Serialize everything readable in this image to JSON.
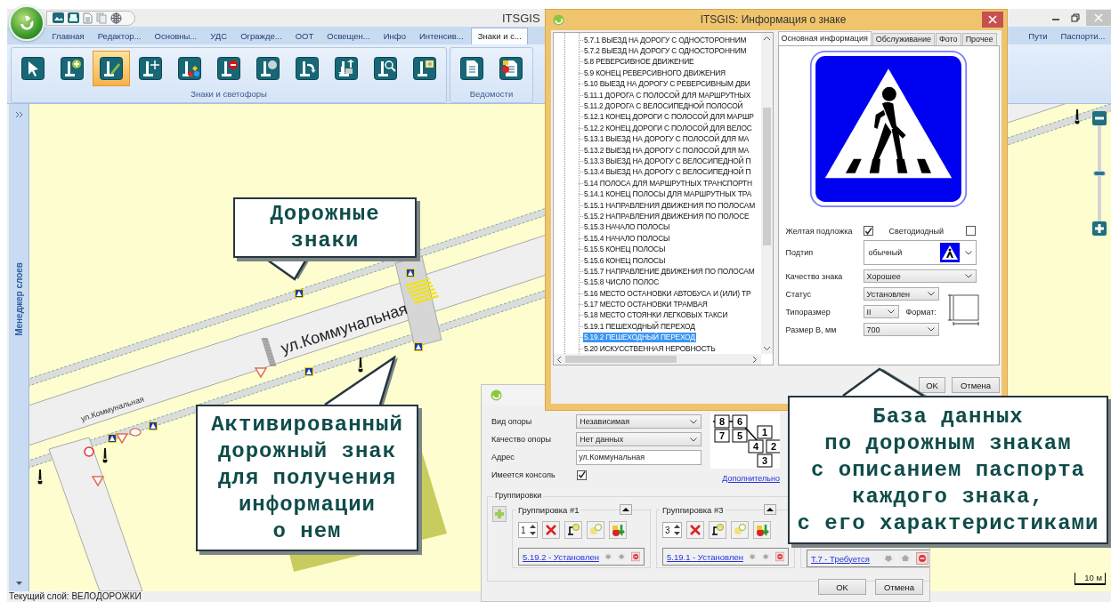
{
  "window": {
    "title": "ITSGIS"
  },
  "ribbon_tabs": [
    {
      "label": "Главная",
      "selected": false
    },
    {
      "label": "Редактор...",
      "selected": false
    },
    {
      "label": "Основны...",
      "selected": false
    },
    {
      "label": "УДС",
      "selected": false
    },
    {
      "label": "Огражде...",
      "selected": false
    },
    {
      "label": "ООТ",
      "selected": false
    },
    {
      "label": "Освещен...",
      "selected": false
    },
    {
      "label": "Инфо",
      "selected": false
    },
    {
      "label": "Интенсив...",
      "selected": false
    },
    {
      "label": "Знаки и с...",
      "selected": true
    }
  ],
  "ribbon_tabs_right": [
    {
      "label": "Пути",
      "selected": false
    },
    {
      "label": "Паспорти...",
      "selected": false
    }
  ],
  "ribbon_groups": [
    {
      "label": "Знаки и светофоры",
      "buttons": [
        {
          "selected": false
        },
        {
          "selected": false
        },
        {
          "selected": true
        },
        {
          "selected": false
        },
        {
          "selected": false
        },
        {
          "selected": false
        },
        {
          "selected": false
        },
        {
          "selected": false
        },
        {
          "selected": false
        },
        {
          "selected": false
        },
        {
          "selected": false
        }
      ]
    },
    {
      "label": "Ведомости",
      "buttons": [
        {
          "selected": false
        },
        {
          "selected": false
        }
      ]
    }
  ],
  "layers_panel": {
    "title": "Менеджер слоев"
  },
  "map": {
    "street_labels": [
      "ул.Коммунальная",
      "ул.Коммунальная"
    ],
    "scale": "10 м",
    "zoom": {
      "level": 0.5
    }
  },
  "status_bar": "Текущий слой: ВЕЛОДОРОЖКИ",
  "sign_dialog": {
    "title": "ITSGIS: Информация о знаке",
    "signs": [
      {
        "label": "5.7.1 ВЫЕЗД НА ДОРОГУ С ОДНОСТОРОННИМ",
        "selected": false
      },
      {
        "label": "5.7.2 ВЫЕЗД НА ДОРОГУ С ОДНОСТОРОННИМ",
        "selected": false
      },
      {
        "label": "5.8 РЕВЕРСИВНОЕ ДВИЖЕНИЕ",
        "selected": false
      },
      {
        "label": "5.9 КОНЕЦ РЕВЕРСИВНОГО ДВИЖЕНИЯ",
        "selected": false
      },
      {
        "label": "5.10 ВЫЕЗД НА ДОРОГУ С РЕВЕРСИВНЫМ ДВИ",
        "selected": false
      },
      {
        "label": "5.11.1 ДОРОГА С ПОЛОСОЙ ДЛЯ МАРШРУТНЫХ",
        "selected": false
      },
      {
        "label": "5.11.2 ДОРОГА С ВЕЛОСИПЕДНОЙ ПОЛОСОЙ",
        "selected": false
      },
      {
        "label": "5.12.1 КОНЕЦ ДОРОГИ С ПОЛОСОЙ ДЛЯ МАРШР",
        "selected": false
      },
      {
        "label": "5.12.2 КОНЕЦ ДОРОГИ С ПОЛОСОЙ ДЛЯ ВЕЛОС",
        "selected": false
      },
      {
        "label": "5.13.1 ВЫЕЗД НА ДОРОГУ С ПОЛОСОЙ ДЛЯ МА",
        "selected": false
      },
      {
        "label": "5.13.2 ВЫЕЗД НА ДОРОГУ С ПОЛОСОЙ ДЛЯ МА",
        "selected": false
      },
      {
        "label": "5.13.3 ВЫЕЗД НА ДОРОГУ С ВЕЛОСИПЕДНОЙ П",
        "selected": false
      },
      {
        "label": "5.13.4 ВЫЕЗД НА ДОРОГУ С ВЕЛОСИПЕДНОЙ П",
        "selected": false
      },
      {
        "label": "5.14 ПОЛОСА ДЛЯ МАРШРУТНЫХ ТРАНСПОРТН",
        "selected": false
      },
      {
        "label": "5.14.1 КОНЕЦ ПОЛОСЫ ДЛЯ МАРШРУТНЫХ ТРА",
        "selected": false
      },
      {
        "label": "5.15.1 НАПРАВЛЕНИЯ ДВИЖЕНИЯ ПО ПОЛОСАМ",
        "selected": false
      },
      {
        "label": "5.15.2 НАПРАВЛЕНИЯ ДВИЖЕНИЯ ПО ПОЛОСЕ",
        "selected": false
      },
      {
        "label": "5.15.3 НАЧАЛО ПОЛОСЫ",
        "selected": false
      },
      {
        "label": "5.15.4 НАЧАЛО ПОЛОСЫ",
        "selected": false
      },
      {
        "label": "5.15.5 КОНЕЦ ПОЛОСЫ",
        "selected": false
      },
      {
        "label": "5.15.6 КОНЕЦ ПОЛОСЫ",
        "selected": false
      },
      {
        "label": "5.15.7 НАПРАВЛЕНИЕ ДВИЖЕНИЯ ПО ПОЛОСАМ",
        "selected": false
      },
      {
        "label": "5.15.8 ЧИСЛО ПОЛОС",
        "selected": false
      },
      {
        "label": "5.16 МЕСТО ОСТАНОВКИ АВТОБУСА И (ИЛИ) ТР",
        "selected": false
      },
      {
        "label": "5.17 МЕСТО ОСТАНОВКИ ТРАМВАЯ",
        "selected": false
      },
      {
        "label": "5.18 МЕСТО СТОЯНКИ ЛЕГКОВЫХ ТАКСИ",
        "selected": false
      },
      {
        "label": "5.19.1 ПЕШЕХОДНЫЙ ПЕРЕХОД",
        "selected": false
      },
      {
        "label": "5.19.2 ПЕШЕХОДНЫЙ ПЕРЕХОД",
        "selected": true
      },
      {
        "label": "5.20 ИСКУССТВЕННАЯ НЕРОВНОСТЬ",
        "selected": false
      }
    ],
    "tabs": [
      {
        "label": "Основная информация",
        "selected": true
      },
      {
        "label": "Обслуживание",
        "selected": false
      },
      {
        "label": "Фото",
        "selected": false
      },
      {
        "label": "Прочее",
        "selected": false
      }
    ],
    "yellow_backing": {
      "label": "Желтая подложка",
      "checked": true
    },
    "led": {
      "label": "Светодиодный",
      "checked": false
    },
    "subtype": {
      "label": "Подтип",
      "value": "обычный"
    },
    "quality": {
      "label": "Качество знака",
      "value": "Хорошее"
    },
    "status": {
      "label": "Статус",
      "value": "Установлен"
    },
    "size_type": {
      "label": "Типоразмер",
      "value": "II"
    },
    "format_label": "Формат:",
    "size": {
      "label": "Размер В, мм",
      "value": "700"
    },
    "buttons": [
      "OK",
      "Отмена"
    ]
  },
  "support_dialog": {
    "fields": [
      {
        "kind": "select",
        "label": "Вид опоры",
        "value": "Независимая"
      },
      {
        "kind": "select",
        "label": "Качество опоры",
        "value": "Нет данных"
      },
      {
        "kind": "text",
        "label": "Адрес",
        "value": "ул.Коммунальная"
      },
      {
        "kind": "checkbox",
        "label": "Имеется консоль",
        "checked": true
      }
    ],
    "position_numbers": [
      "8",
      "6",
      "7",
      "5",
      "1",
      "4",
      "2",
      "3"
    ],
    "more_link": "Дополнительно",
    "groupings_title": "Группировки",
    "groups": [
      {
        "title": "Группировка #1",
        "count": "1",
        "sign": "5.19.2 - Установлен"
      },
      {
        "title": "Группировка #3",
        "count": "3",
        "sign": "5.19.1 - Установлен"
      },
      {
        "sign": "Т.7 - Требуется"
      }
    ],
    "buttons": [
      "OK",
      "Отмена"
    ]
  },
  "callouts": [
    {
      "text": "Дорожные\nзнаки"
    },
    {
      "text": "Активированный\nдорожный знак\nдля получения\nинформации\nо нем"
    },
    {
      "text": "База данных\nпо дорожным знакам\nс описанием паспорта\nкаждого знака,\nс его характеристиками"
    }
  ]
}
